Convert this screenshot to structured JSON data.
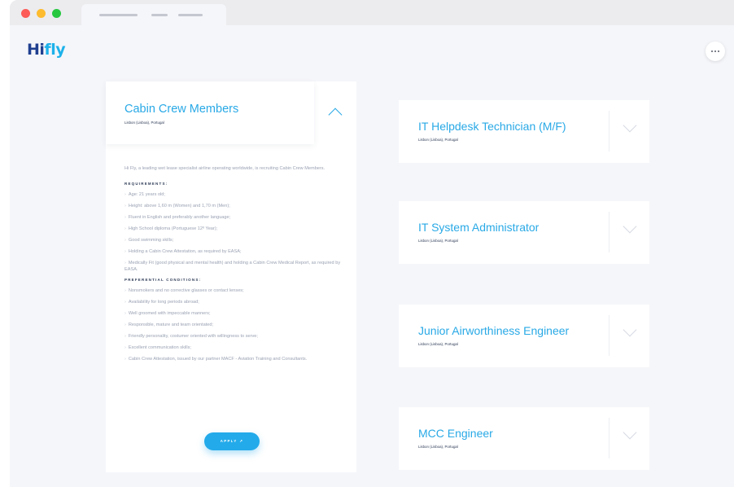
{
  "brand": {
    "logo_part1": "Hi",
    "logo_part2": "fly"
  },
  "expanded_job": {
    "title": "Cabin Crew Members",
    "location": "Lisbon (Lisboa), Portugal",
    "intro": "Hi Fly, a leading wet lease specialist airline operating worldwide, is recruiting Cabin Crew Members.",
    "requirements_heading": "REQUIREMENTS:",
    "requirements": [
      "Age: 21 years old;",
      "Height: above 1,60 m (Women) and 1,70 m (Men);",
      "Fluent in English and preferably another language;",
      "High School diploma (Portuguese 12º Year);",
      "Good swimming skills;",
      "Holding a Cabin Crew Attestation, as required by EASA;",
      "Medically Fit (good physical and mental health) and holding a Cabin Crew Medical Report, as required by EASA."
    ],
    "preferential_heading": "PREFERENTIAL CONDITIONS:",
    "preferential": [
      "Nonsmokers and no corrective glasses or contact lenses;",
      "Availability for long periods abroad;",
      "Well groomed with impeccable manners;",
      "Responsible, mature and team orientated;",
      "Friendly personality, costumer oriented with willingness to serve;",
      "Excellent communication skills;",
      "Cabin Crew Attestation, issued by our partner MACF - Aviation Training and Consultants."
    ],
    "apply_label": "APPLY ↗"
  },
  "jobs": [
    {
      "title": "IT Helpdesk Technician (M/F)",
      "location": "Lisbon (Lisboa), Portugal"
    },
    {
      "title": "IT System Administrator",
      "location": "Lisbon (Lisboa), Portugal"
    },
    {
      "title": "Junior Airworthiness Engineer",
      "location": "Lisbon (Lisboa), Portugal"
    },
    {
      "title": "MCC Engineer",
      "location": "Lisbon (Lisboa), Portugal"
    }
  ],
  "bullet": "›",
  "colors": {
    "accent": "#29a9e6",
    "brand_dark": "#1f3f8f",
    "page_bg": "#f5f6fa",
    "text_dark": "#2c3a55"
  }
}
